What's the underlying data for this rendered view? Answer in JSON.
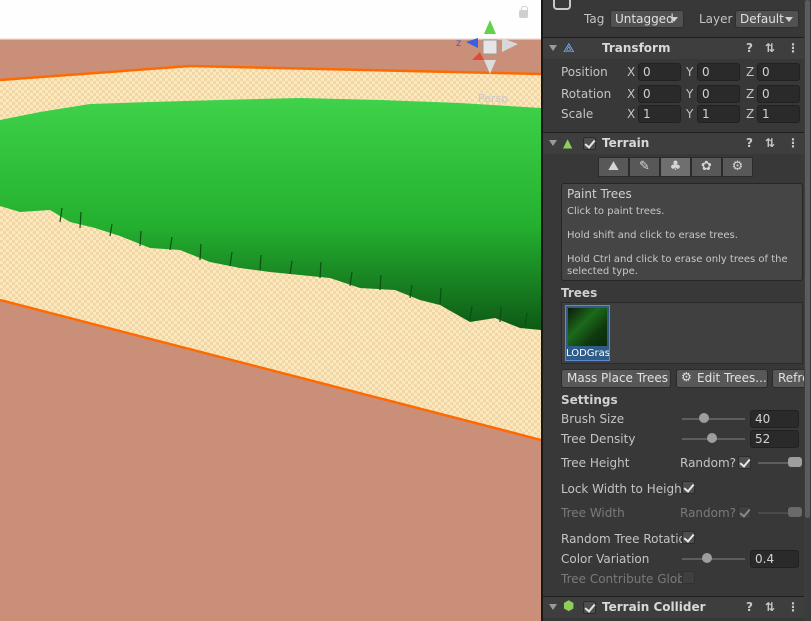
{
  "scene": {
    "view_label": "Persp",
    "colors": {
      "ground": "#c98f78",
      "grass": "#1fa52a",
      "terrain_selection": "#ff6a00"
    }
  },
  "header": {
    "tag_label": "Tag",
    "tag_value": "Untagged",
    "layer_label": "Layer",
    "layer_value": "Default"
  },
  "transform": {
    "title": "Transform",
    "rows": [
      {
        "label": "Position",
        "x": "0",
        "y": "0",
        "z": "0"
      },
      {
        "label": "Rotation",
        "x": "0",
        "y": "0",
        "z": "0"
      },
      {
        "label": "Scale",
        "x": "1",
        "y": "1",
        "z": "1"
      }
    ],
    "axis": {
      "x": "X",
      "y": "Y",
      "z": "Z"
    }
  },
  "terrain": {
    "title": "Terrain",
    "help": {
      "heading": "Paint Trees",
      "line1": "Click to paint trees.",
      "line2": "Hold shift and click to erase trees.",
      "line3": "Hold Ctrl and click to erase only trees of the selected type."
    },
    "trees_label": "Trees",
    "tree_item": "LODGrass",
    "buttons": {
      "mass_place": "Mass Place Trees",
      "edit_trees": "Edit Trees...",
      "refresh": "Refresh"
    },
    "settings_label": "Settings",
    "brush_size": {
      "label": "Brush Size",
      "value": "40",
      "fraction": 0.35
    },
    "tree_density": {
      "label": "Tree Density",
      "value": "52",
      "fraction": 0.47
    },
    "tree_height": {
      "label": "Tree Height",
      "random_label": "Random?"
    },
    "lock_width": {
      "label": "Lock Width to Height"
    },
    "tree_width": {
      "label": "Tree Width",
      "random_label": "Random?"
    },
    "random_rotation": {
      "label": "Random Tree Rotatio"
    },
    "color_variation": {
      "label": "Color Variation",
      "value": "0.4",
      "fraction": 0.4
    },
    "contribute_gi": {
      "label": "Tree Contribute Globa"
    }
  },
  "terrain_collider": {
    "title": "Terrain Collider"
  }
}
